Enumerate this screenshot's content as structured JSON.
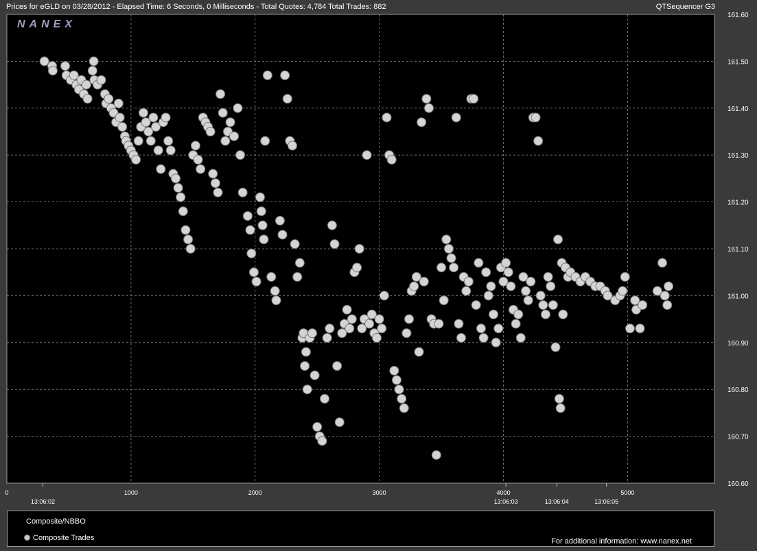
{
  "header": {
    "left_text": "Prices for  eGLD  on  03/28/2012  -  Elapsed Time: 6 Seconds, 0 Milliseconds  -  Total Quotes: 4,784  Total Trades: 882",
    "right_text": "QTSequencer G3"
  },
  "logo_text": "NANEX",
  "legend": {
    "item1": "Composite/NBBO",
    "item2": "Composite Trades",
    "info": "For additional information: www.nanex.net"
  },
  "colors": {
    "background": "#000000",
    "frame": "#3a3a3a",
    "marker": "#d4d4d4",
    "grid": "#8a8a8a",
    "logo": "#9aa0c0"
  },
  "chart_data": {
    "type": "scatter",
    "title": "",
    "xlabel": "",
    "ylabel": "",
    "xlim": [
      0,
      5700
    ],
    "ylim": [
      160.6,
      161.6
    ],
    "x_ticks": [
      0,
      1000,
      2000,
      3000,
      4000,
      5000
    ],
    "y_ticks": [
      "161.60",
      "161.50",
      "161.40",
      "161.30",
      "161.20",
      "161.10",
      "161.00",
      "160.90",
      "160.80",
      "160.70",
      "160.60"
    ],
    "time_labels": [
      {
        "x": 290,
        "label": "13:06:02"
      },
      {
        "x": 4020,
        "label": "13:06:03"
      },
      {
        "x": 4430,
        "label": "13:06:04"
      },
      {
        "x": 4830,
        "label": "13:06:05"
      }
    ],
    "grid": true,
    "series": [
      {
        "name": "Composite Trades",
        "points": [
          [
            302,
            161.5
          ],
          [
            365,
            161.49
          ],
          [
            370,
            161.48
          ],
          [
            470,
            161.49
          ],
          [
            480,
            161.47
          ],
          [
            515,
            161.46
          ],
          [
            540,
            161.47
          ],
          [
            560,
            161.45
          ],
          [
            580,
            161.44
          ],
          [
            600,
            161.46
          ],
          [
            620,
            161.43
          ],
          [
            640,
            161.45
          ],
          [
            650,
            161.42
          ],
          [
            690,
            161.48
          ],
          [
            700,
            161.5
          ],
          [
            705,
            161.46
          ],
          [
            730,
            161.45
          ],
          [
            760,
            161.46
          ],
          [
            790,
            161.43
          ],
          [
            800,
            161.41
          ],
          [
            820,
            161.42
          ],
          [
            840,
            161.4
          ],
          [
            860,
            161.39
          ],
          [
            880,
            161.37
          ],
          [
            900,
            161.41
          ],
          [
            910,
            161.38
          ],
          [
            930,
            161.36
          ],
          [
            950,
            161.34
          ],
          [
            960,
            161.33
          ],
          [
            980,
            161.32
          ],
          [
            1000,
            161.31
          ],
          [
            1020,
            161.3
          ],
          [
            1040,
            161.29
          ],
          [
            1060,
            161.33
          ],
          [
            1080,
            161.36
          ],
          [
            1100,
            161.39
          ],
          [
            1120,
            161.37
          ],
          [
            1140,
            161.35
          ],
          [
            1160,
            161.33
          ],
          [
            1180,
            161.38
          ],
          [
            1200,
            161.36
          ],
          [
            1220,
            161.31
          ],
          [
            1240,
            161.27
          ],
          [
            1260,
            161.37
          ],
          [
            1280,
            161.38
          ],
          [
            1300,
            161.33
          ],
          [
            1320,
            161.31
          ],
          [
            1340,
            161.26
          ],
          [
            1360,
            161.25
          ],
          [
            1380,
            161.23
          ],
          [
            1400,
            161.21
          ],
          [
            1420,
            161.18
          ],
          [
            1440,
            161.14
          ],
          [
            1460,
            161.12
          ],
          [
            1480,
            161.1
          ],
          [
            1500,
            161.3
          ],
          [
            1520,
            161.32
          ],
          [
            1540,
            161.29
          ],
          [
            1560,
            161.27
          ],
          [
            1580,
            161.38
          ],
          [
            1600,
            161.37
          ],
          [
            1620,
            161.36
          ],
          [
            1640,
            161.35
          ],
          [
            1660,
            161.26
          ],
          [
            1680,
            161.24
          ],
          [
            1700,
            161.22
          ],
          [
            1720,
            161.43
          ],
          [
            1740,
            161.39
          ],
          [
            1760,
            161.33
          ],
          [
            1780,
            161.35
          ],
          [
            1800,
            161.37
          ],
          [
            1830,
            161.34
          ],
          [
            1860,
            161.4
          ],
          [
            1880,
            161.3
          ],
          [
            1900,
            161.22
          ],
          [
            1940,
            161.17
          ],
          [
            1960,
            161.14
          ],
          [
            1970,
            161.09
          ],
          [
            1990,
            161.05
          ],
          [
            2010,
            161.03
          ],
          [
            2040,
            161.21
          ],
          [
            2050,
            161.18
          ],
          [
            2060,
            161.15
          ],
          [
            2070,
            161.12
          ],
          [
            2080,
            161.33
          ],
          [
            2100,
            161.47
          ],
          [
            2130,
            161.04
          ],
          [
            2160,
            161.01
          ],
          [
            2170,
            160.99
          ],
          [
            2200,
            161.16
          ],
          [
            2220,
            161.13
          ],
          [
            2240,
            161.47
          ],
          [
            2260,
            161.42
          ],
          [
            2280,
            161.33
          ],
          [
            2300,
            161.32
          ],
          [
            2320,
            161.11
          ],
          [
            2340,
            161.04
          ],
          [
            2360,
            161.07
          ],
          [
            2380,
            160.91
          ],
          [
            2390,
            160.92
          ],
          [
            2400,
            160.85
          ],
          [
            2410,
            160.88
          ],
          [
            2420,
            160.8
          ],
          [
            2440,
            160.91
          ],
          [
            2460,
            160.92
          ],
          [
            2480,
            160.83
          ],
          [
            2500,
            160.72
          ],
          [
            2520,
            160.7
          ],
          [
            2540,
            160.69
          ],
          [
            2560,
            160.78
          ],
          [
            2580,
            160.91
          ],
          [
            2600,
            160.93
          ],
          [
            2620,
            161.15
          ],
          [
            2640,
            161.11
          ],
          [
            2660,
            160.85
          ],
          [
            2680,
            160.73
          ],
          [
            2700,
            160.92
          ],
          [
            2720,
            160.94
          ],
          [
            2740,
            160.97
          ],
          [
            2760,
            160.93
          ],
          [
            2780,
            160.95
          ],
          [
            2800,
            161.05
          ],
          [
            2820,
            161.06
          ],
          [
            2840,
            161.1
          ],
          [
            2860,
            160.93
          ],
          [
            2880,
            160.95
          ],
          [
            2900,
            161.3
          ],
          [
            2920,
            160.94
          ],
          [
            2940,
            160.96
          ],
          [
            2960,
            160.92
          ],
          [
            2980,
            160.91
          ],
          [
            3000,
            160.95
          ],
          [
            3020,
            160.93
          ],
          [
            3040,
            161.0
          ],
          [
            3060,
            161.38
          ],
          [
            3080,
            161.3
          ],
          [
            3100,
            161.29
          ],
          [
            3120,
            160.84
          ],
          [
            3140,
            160.82
          ],
          [
            3160,
            160.8
          ],
          [
            3180,
            160.78
          ],
          [
            3200,
            160.76
          ],
          [
            3220,
            160.92
          ],
          [
            3240,
            160.95
          ],
          [
            3260,
            161.01
          ],
          [
            3280,
            161.02
          ],
          [
            3300,
            161.04
          ],
          [
            3320,
            160.88
          ],
          [
            3340,
            161.37
          ],
          [
            3360,
            161.03
          ],
          [
            3380,
            161.42
          ],
          [
            3400,
            161.4
          ],
          [
            3420,
            160.95
          ],
          [
            3440,
            160.94
          ],
          [
            3460,
            160.66
          ],
          [
            3480,
            160.94
          ],
          [
            3500,
            161.06
          ],
          [
            3520,
            160.99
          ],
          [
            3540,
            161.12
          ],
          [
            3560,
            161.1
          ],
          [
            3580,
            161.08
          ],
          [
            3600,
            161.06
          ],
          [
            3620,
            161.38
          ],
          [
            3640,
            160.94
          ],
          [
            3660,
            160.91
          ],
          [
            3680,
            161.04
          ],
          [
            3700,
            161.01
          ],
          [
            3720,
            161.03
          ],
          [
            3740,
            161.42
          ],
          [
            3760,
            161.42
          ],
          [
            3780,
            160.98
          ],
          [
            3800,
            161.07
          ],
          [
            3820,
            160.93
          ],
          [
            3840,
            160.91
          ],
          [
            3860,
            161.05
          ],
          [
            3880,
            161.0
          ],
          [
            3900,
            161.02
          ],
          [
            3920,
            160.96
          ],
          [
            3940,
            160.9
          ],
          [
            3960,
            160.93
          ],
          [
            3980,
            161.06
          ],
          [
            4000,
            161.03
          ],
          [
            4020,
            161.07
          ],
          [
            4040,
            161.05
          ],
          [
            4060,
            161.02
          ],
          [
            4080,
            160.97
          ],
          [
            4100,
            160.94
          ],
          [
            4120,
            160.96
          ],
          [
            4140,
            160.91
          ],
          [
            4160,
            161.04
          ],
          [
            4180,
            161.01
          ],
          [
            4200,
            160.99
          ],
          [
            4220,
            161.03
          ],
          [
            4240,
            161.38
          ],
          [
            4260,
            161.38
          ],
          [
            4280,
            161.33
          ],
          [
            4300,
            161.0
          ],
          [
            4320,
            160.98
          ],
          [
            4340,
            160.96
          ],
          [
            4360,
            161.04
          ],
          [
            4380,
            161.02
          ],
          [
            4400,
            160.98
          ],
          [
            4420,
            160.89
          ],
          [
            4440,
            161.12
          ],
          [
            4450,
            160.78
          ],
          [
            4460,
            160.76
          ],
          [
            4470,
            161.07
          ],
          [
            4480,
            160.96
          ],
          [
            4500,
            161.06
          ],
          [
            4520,
            161.04
          ],
          [
            4540,
            161.05
          ],
          [
            4580,
            161.04
          ],
          [
            4620,
            161.03
          ],
          [
            4660,
            161.04
          ],
          [
            4700,
            161.03
          ],
          [
            4740,
            161.02
          ],
          [
            4780,
            161.02
          ],
          [
            4820,
            161.01
          ],
          [
            4840,
            161.0
          ],
          [
            4900,
            160.99
          ],
          [
            4940,
            161.0
          ],
          [
            4960,
            161.01
          ],
          [
            4980,
            161.04
          ],
          [
            5020,
            160.93
          ],
          [
            5060,
            160.99
          ],
          [
            5070,
            160.97
          ],
          [
            5100,
            160.93
          ],
          [
            5120,
            160.98
          ],
          [
            5240,
            161.01
          ],
          [
            5280,
            161.07
          ],
          [
            5300,
            161.0
          ],
          [
            5320,
            160.98
          ],
          [
            5330,
            161.02
          ]
        ]
      }
    ]
  }
}
